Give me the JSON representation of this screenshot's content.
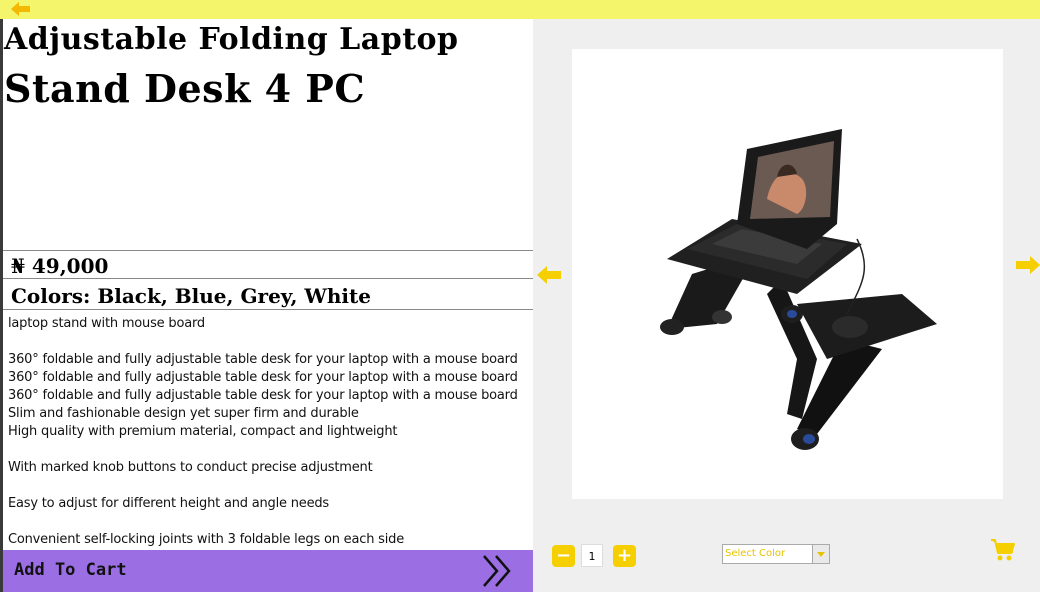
{
  "product": {
    "title_line1": "Adjustable Folding Laptop",
    "title_line2": "Stand Desk 4 PC",
    "price": "₦ 49,000",
    "colors": "Colors: Black, Blue, Grey, White",
    "description": "laptop stand with mouse board\n\n360° foldable and fully adjustable table desk for your laptop with a mouse board\n360° foldable and fully adjustable table desk for your laptop with a mouse board\n360° foldable and fully adjustable table desk for your laptop with a mouse board\nSlim and fashionable design yet super firm and durable\nHigh quality with premium material, compact and lightweight\n\nWith marked knob buttons to conduct precise adjustment\n\nEasy to adjust for different height and angle needs\n\nConvenient self-locking joints with 3 foldable legs on each side"
  },
  "actions": {
    "add_to_cart": "Add To Cart"
  },
  "quantity": {
    "minus": "−",
    "value": "1",
    "plus": "+"
  },
  "color_select": {
    "selected": "Select Color"
  },
  "colors_theme": {
    "accent_yellow": "#f5cf00",
    "top_bar": "#f4f56a",
    "cart_button": "#9b6fe3"
  },
  "icons": [
    "back-arrow-icon",
    "prev-arrow-icon",
    "next-arrow-icon",
    "chevron-double-right-icon",
    "shopping-cart-icon",
    "dropdown-arrow-icon"
  ]
}
